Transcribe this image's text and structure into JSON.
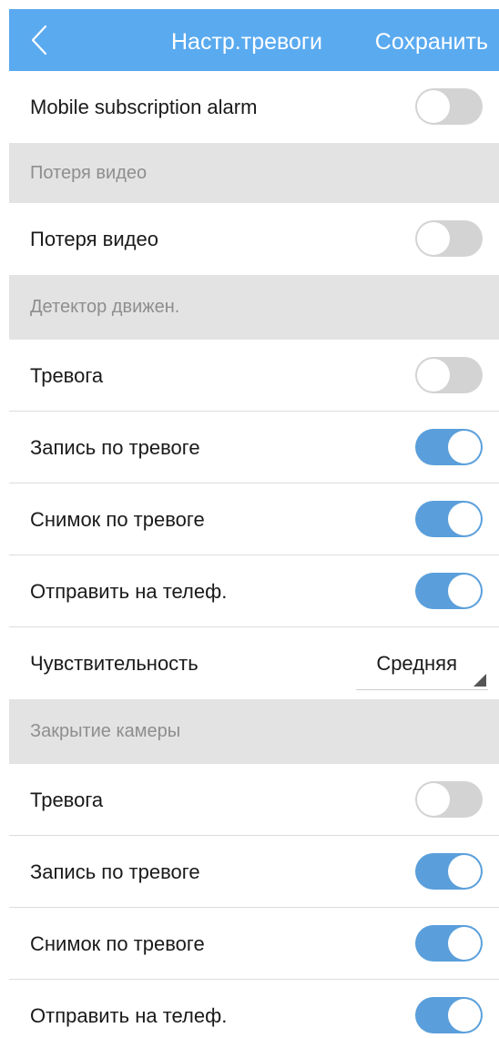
{
  "header": {
    "title": "Настр.тревоги",
    "save_label": "Сохранить",
    "back_icon": "chevron-left-icon",
    "color": "#5aaaf0"
  },
  "mobile_subscription": {
    "label": "Mobile subscription alarm",
    "enabled": false
  },
  "video_loss": {
    "section_title": "Потеря видео",
    "items": [
      {
        "label": "Потеря видео",
        "enabled": false
      }
    ]
  },
  "motion_detection": {
    "section_title": "Детектор движен.",
    "items": [
      {
        "label": "Тревога",
        "enabled": false
      },
      {
        "label": "Запись по тревоге",
        "enabled": true
      },
      {
        "label": "Снимок по тревоге",
        "enabled": true
      },
      {
        "label": "Отправить на телеф.",
        "enabled": true
      }
    ],
    "sensitivity": {
      "label": "Чувствительность",
      "value": "Средняя"
    }
  },
  "camera_tamper": {
    "section_title": "Закрытие камеры",
    "items": [
      {
        "label": "Тревога",
        "enabled": false
      },
      {
        "label": "Запись по тревоге",
        "enabled": true
      },
      {
        "label": "Снимок по тревоге",
        "enabled": true
      },
      {
        "label": "Отправить на телеф.",
        "enabled": true
      }
    ]
  },
  "colors": {
    "toggle_on": "#5a9fdb",
    "toggle_off": "#d3d3d3",
    "section_bg": "#e3e3e3"
  }
}
